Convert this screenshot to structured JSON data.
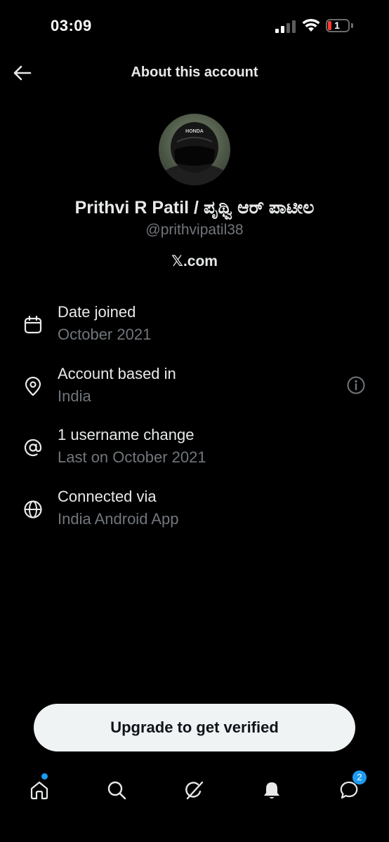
{
  "status_bar": {
    "time": "03:09",
    "battery_level": "1",
    "battery_color": "#ff3b30"
  },
  "header": {
    "title": "About this account",
    "back_icon": "arrow-left-icon"
  },
  "profile": {
    "display_name": "Prithvi R Patil / ಪೃಥ್ವಿ ಆರ್ ಪಾಟೀಲ",
    "handle": "@prithvipatil38",
    "site": "𝕏.com",
    "avatar_helmet_text": "HONDA"
  },
  "info": [
    {
      "icon": "calendar-icon",
      "title": "Date joined",
      "subtitle": "October 2021"
    },
    {
      "icon": "location-pin-icon",
      "title": "Account based in",
      "subtitle": "India",
      "action_icon": "info-circle-icon"
    },
    {
      "icon": "at-sign-icon",
      "title": "1 username change",
      "subtitle": "Last on October 2021"
    },
    {
      "icon": "globe-icon",
      "title": "Connected via",
      "subtitle": "India Android App"
    }
  ],
  "upgrade": {
    "label": "Upgrade to get verified"
  },
  "nav": {
    "items": [
      {
        "icon": "home-icon",
        "has_dot": true
      },
      {
        "icon": "search-icon"
      },
      {
        "icon": "grok-icon"
      },
      {
        "icon": "bell-icon"
      },
      {
        "icon": "messages-icon"
      }
    ],
    "messages_badge": "2",
    "badge_color": "#1d9bf0"
  },
  "colors": {
    "background": "#000000",
    "primary_text": "#e7e9ea",
    "secondary_text": "#71767b",
    "button_bg": "#eff3f4"
  }
}
